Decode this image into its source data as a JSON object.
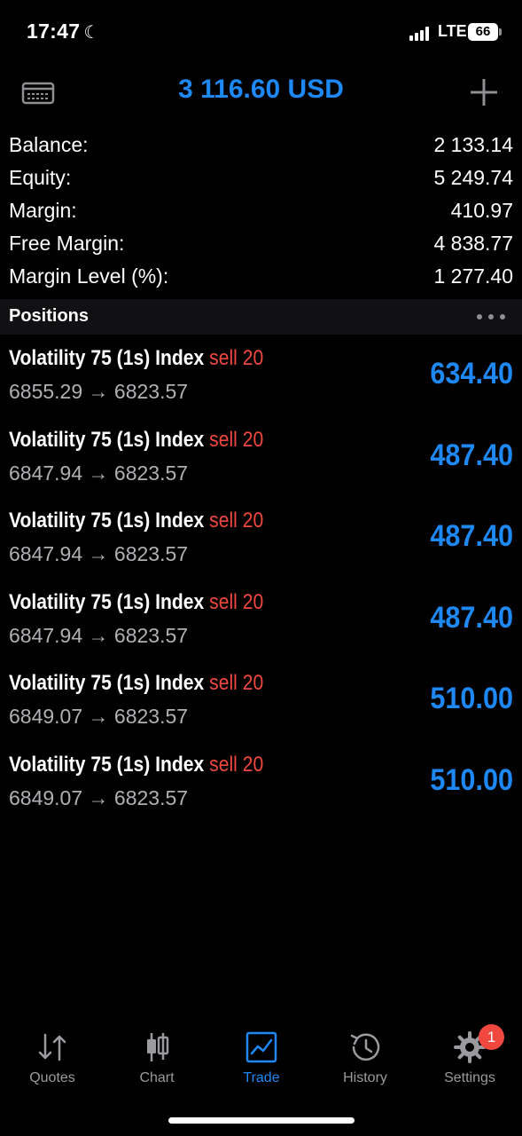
{
  "status_bar": {
    "time": "17:47",
    "network": "LTE",
    "battery": "66"
  },
  "header": {
    "title": "3 116.60 USD",
    "left_icon": "terminal-icon",
    "right_icon": "plus-icon"
  },
  "summary": [
    {
      "label": "Balance:",
      "value": "2 133.14"
    },
    {
      "label": "Equity:",
      "value": "5 249.74"
    },
    {
      "label": "Margin:",
      "value": "410.97"
    },
    {
      "label": "Free Margin:",
      "value": "4 838.77"
    },
    {
      "label": "Margin Level (%):",
      "value": "1 277.40"
    }
  ],
  "positions_section": {
    "title": "Positions"
  },
  "positions": [
    {
      "symbol": "Volatility 75 (1s) Index",
      "side": "sell 20",
      "prices": "6855.29 → 6823.57",
      "profit": "634.40"
    },
    {
      "symbol": "Volatility 75 (1s) Index",
      "side": "sell 20",
      "prices": "6847.94 → 6823.57",
      "profit": "487.40"
    },
    {
      "symbol": "Volatility 75 (1s) Index",
      "side": "sell 20",
      "prices": "6847.94 → 6823.57",
      "profit": "487.40"
    },
    {
      "symbol": "Volatility 75 (1s) Index",
      "side": "sell 20",
      "prices": "6847.94 → 6823.57",
      "profit": "487.40"
    },
    {
      "symbol": "Volatility 75 (1s) Index",
      "side": "sell 20",
      "prices": "6849.07 → 6823.57",
      "profit": "510.00"
    },
    {
      "symbol": "Volatility 75 (1s) Index",
      "side": "sell 20",
      "prices": "6849.07 → 6823.57",
      "profit": "510.00"
    }
  ],
  "tabs": [
    {
      "label": "Quotes",
      "icon": "quotes-arrows-icon"
    },
    {
      "label": "Chart",
      "icon": "candlestick-chart-icon"
    },
    {
      "label": "Trade",
      "icon": "trade-chart-icon",
      "active": true
    },
    {
      "label": "History",
      "icon": "history-clock-icon"
    },
    {
      "label": "Settings",
      "icon": "gear-icon",
      "badge": "1"
    }
  ],
  "colors": {
    "accent": "#1e88f5",
    "sell": "#f0483e",
    "background": "#000000",
    "inactive_tab": "#9a9a9f"
  }
}
